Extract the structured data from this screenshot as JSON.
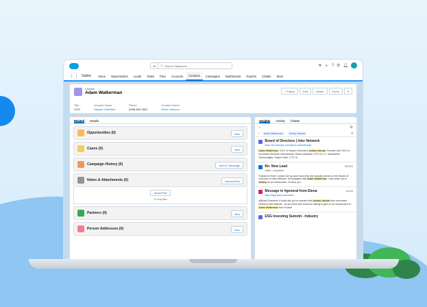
{
  "nav": {
    "app_name": "Sales",
    "items": [
      "Home",
      "Opportunities",
      "Leads",
      "Tasks",
      "Files",
      "Accounts",
      "Contacts",
      "Campaigns",
      "Dashboards",
      "Reports",
      "Chatter",
      "More"
    ]
  },
  "search": {
    "scope": "All",
    "placeholder": "Search Salesforce"
  },
  "record": {
    "type": "Contact",
    "name": "Adam Walkerman",
    "actions": [
      "+ Follow",
      "Edit",
      "Delete",
      "Clone"
    ],
    "fields": [
      {
        "label": "Title",
        "value": "COO"
      },
      {
        "label": "Account Name",
        "value": "Harpen Unlimited"
      },
      {
        "label": "Phone",
        "value": "(408) 800-2822"
      },
      {
        "label": "Contact Owner",
        "value": "Elena Johnson"
      }
    ]
  },
  "left_tabs": [
    "Related",
    "Details"
  ],
  "related_lists": [
    {
      "title": "Opportunities (0)",
      "button": "New",
      "color": "#fcb95b"
    },
    {
      "title": "Cases (0)",
      "button": "New",
      "color": "#f2cf5b"
    },
    {
      "title": "Campaign History (0)",
      "button": "Add to Campaign",
      "color": "#f49756"
    },
    {
      "title": "Notes & Attachments (0)",
      "button": "Upload Files",
      "color": "#939393"
    },
    {
      "title": "Partners (0)",
      "button": "New",
      "color": "#3ba755"
    },
    {
      "title": "Person Addresses (0)",
      "button": "New",
      "color": "#f87c8f"
    }
  ],
  "upload": {
    "button": "Upload Files",
    "drop_text": "Or drop files"
  },
  "right_tabs": [
    "Insights",
    "Activity",
    "Chatter"
  ],
  "insight_pills": [
    "Adam Walkerman",
    "Audrey Haruda"
  ],
  "insights": [
    {
      "title": "Board of Directors | Inter Network",
      "subtitle": "https://en.example.com/about-us/leadership",
      "date": "",
      "color": "#5867e8",
      "body_pre": "",
      "mark1": "Adam Walkerman",
      "body_mid": ", COO of Harpen Unlimited, ",
      "mark2": "Audrey Haruda",
      "body_post": ", Founder and CEO of Innovative Network International. Donna Abdullah, CFO of L.V. Information Technologies, Harper Klein, CTO of"
    },
    {
      "title": "Re: New Lead",
      "subtitle": "Sales > Important",
      "date": "5/29/24",
      "color": "#0176d3",
      "body_pre": "Thanks for that! I looked her up and found that she actually serves on the Board of Directors of Inter Network Technologies with ",
      "mark1": "Adam Walkerman",
      "body_mid": ". I can reach out to ",
      "mark2": "Audrey",
      "body_post": " for an introduction. Ill keep you"
    },
    {
      "title": "Message in #general from Elena",
      "subtitle": "https://app.slack.com/client",
      "date": "6/1/24",
      "color": "#e01e5a",
      "body_pre": "@BrianChambers it looks like you've worked with ",
      "mark1": "Audrey Haruda",
      "body_mid": " from Innovative Network International - do you think she would be willing to give us an introduction to ",
      "mark2": "Adam Walkerman",
      "body_post": " from Rocket"
    },
    {
      "title": "ESG Investing Summit - Industry",
      "subtitle": "",
      "date": "",
      "color": "#5867e8",
      "body_pre": "",
      "mark1": "",
      "body_mid": "",
      "mark2": "",
      "body_post": ""
    }
  ]
}
